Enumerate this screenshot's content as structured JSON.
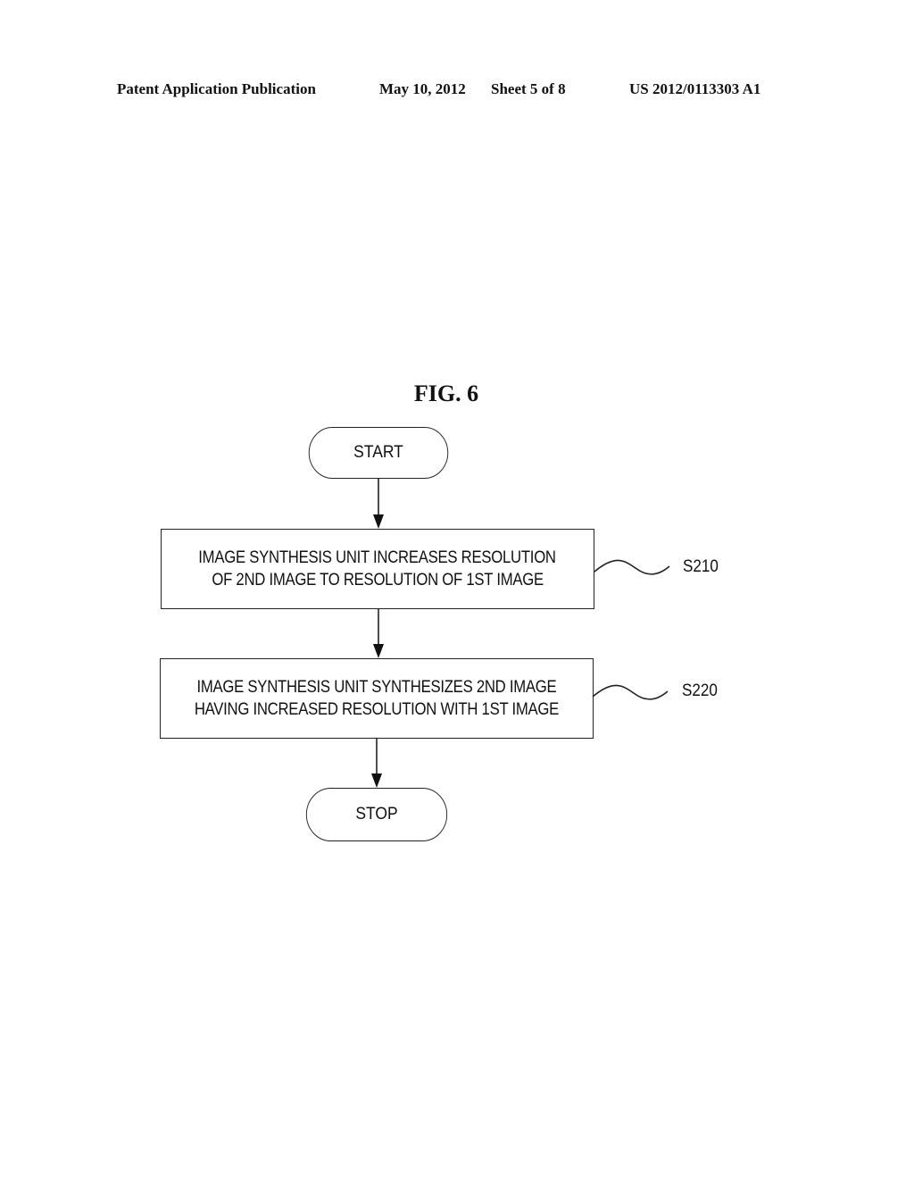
{
  "header": {
    "publication_type": "Patent Application Publication",
    "date": "May 10, 2012",
    "sheet": "Sheet 5 of 8",
    "publication_number": "US 2012/0113303 A1"
  },
  "figure": {
    "title": "FIG. 6",
    "start_label": "START",
    "stop_label": "STOP",
    "steps": [
      {
        "id": "S210",
        "lines": [
          "IMAGE SYNTHESIS UNIT INCREASES RESOLUTION",
          "OF 2ND IMAGE TO RESOLUTION OF 1ST IMAGE"
        ]
      },
      {
        "id": "S220",
        "lines": [
          "IMAGE SYNTHESIS UNIT SYNTHESIZES 2ND IMAGE",
          "HAVING INCREASED RESOLUTION WITH 1ST IMAGE"
        ]
      }
    ]
  }
}
